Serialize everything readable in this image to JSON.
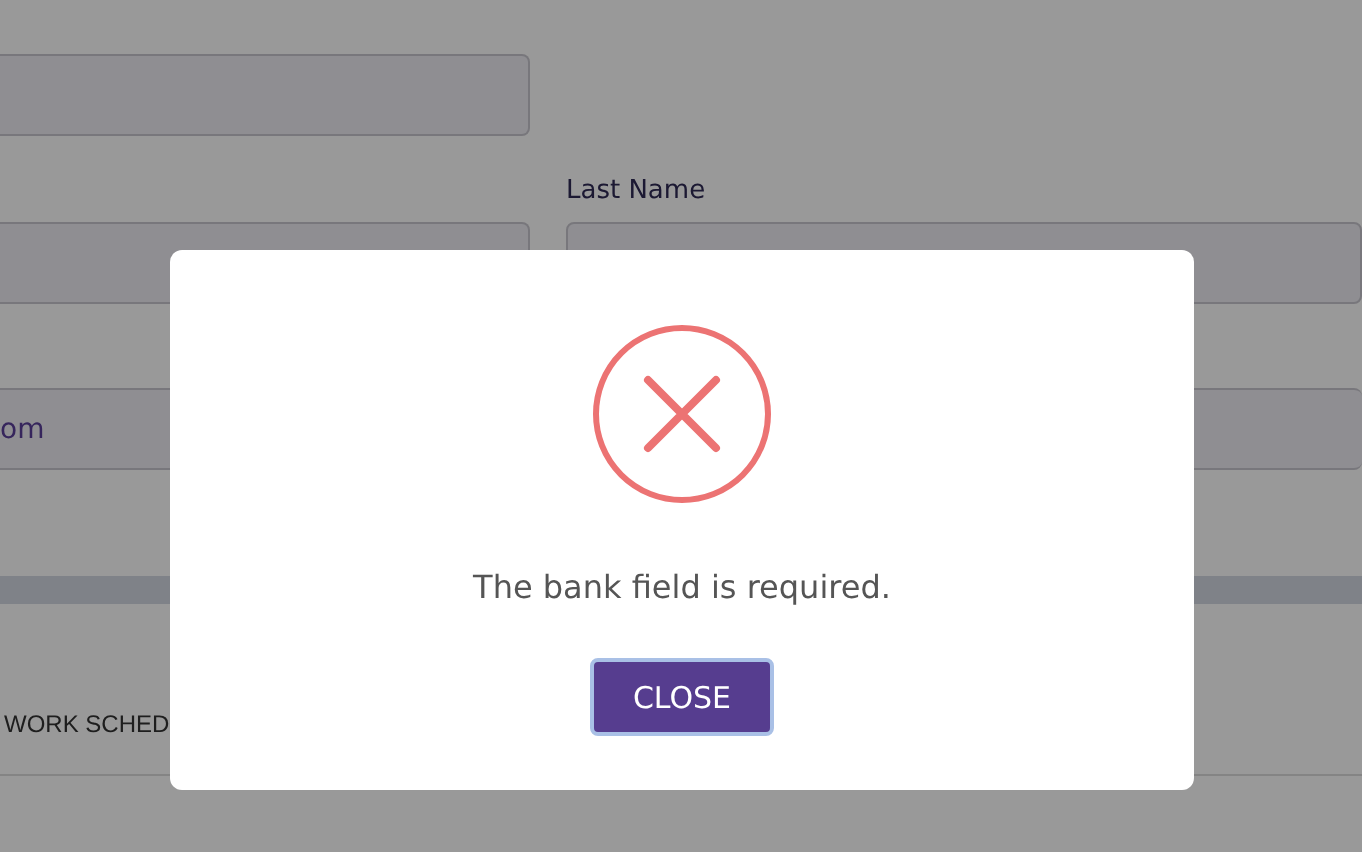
{
  "form": {
    "last_name_label": "Last Name",
    "email_value": "om",
    "section_heading": "WORK SCHED"
  },
  "dialog": {
    "kind": "error",
    "message": "The bank field is required.",
    "button": "CLOSE"
  }
}
